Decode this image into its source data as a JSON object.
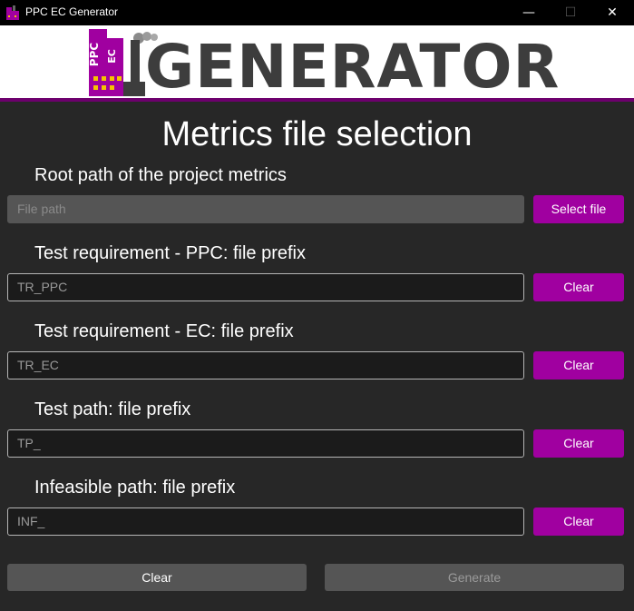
{
  "window": {
    "title": "PPC EC Generator",
    "minimize_glyph": "—",
    "maximize_glyph": "☐",
    "close_glyph": "✕"
  },
  "banner": {
    "logo_word": "GENERATOR",
    "logo_tag_top": "PPC",
    "logo_tag_bottom": "EC",
    "colors": {
      "brand": "#a000a0",
      "dark": "#3d3d3d",
      "window": "#f5c400"
    }
  },
  "main": {
    "title": "Metrics file selection",
    "sections": [
      {
        "label": "Root path of the project metrics",
        "value": "",
        "placeholder": "File path",
        "button": "Select file"
      },
      {
        "label": "Test requirement - PPC: file prefix",
        "value": "TR_PPC",
        "button": "Clear"
      },
      {
        "label": "Test requirement - EC: file prefix",
        "value": "TR_EC",
        "button": "Clear"
      },
      {
        "label": "Test path: file prefix",
        "value": "TP_",
        "button": "Clear"
      },
      {
        "label": "Infeasible path: file prefix",
        "value": "INF_",
        "button": "Clear"
      }
    ]
  },
  "footer": {
    "clear_label": "Clear",
    "generate_label": "Generate",
    "generate_enabled": false
  }
}
